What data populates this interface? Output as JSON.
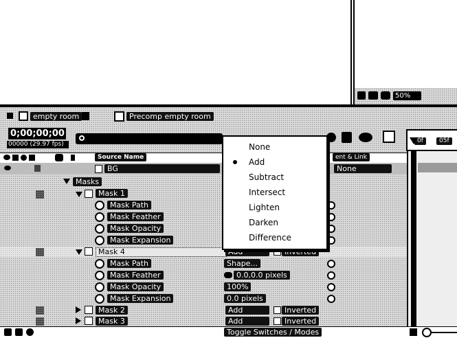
{
  "viewer": {
    "zoom": "50%"
  },
  "comp": {
    "tab_name": "empty room",
    "precomp_label": "Precomp empty room",
    "timecode": "0;00;00;00",
    "frame_info": "00000 (29.97 fps)"
  },
  "columns": {
    "source_name": "Source Name",
    "parent": "ent & Link"
  },
  "layers": {
    "bg_name": "BG",
    "parent_value": "None",
    "masks_group": "Masks",
    "mask1": "Mask 1",
    "mask4": "Mask 4",
    "mask2": "Mask 2",
    "mask3": "Mask 3",
    "mask_path": "Mask Path",
    "mask_feather": "Mask Feather",
    "mask_opacity": "Mask Opacity",
    "mask_expansion": "Mask Expansion",
    "mode_add": "Add",
    "inverted": "Inverted",
    "path_value": "Shape...",
    "feather_value": "0.0,0.0 pixels",
    "opacity_value": "100%",
    "expansion_value": "0.0 pixels"
  },
  "timeline": {
    "tick1": "0f",
    "tick2": "05f"
  },
  "bottom": {
    "toggle_label": "Toggle Switches / Modes"
  },
  "dropdown": {
    "items": [
      "None",
      "Add",
      "Subtract",
      "Intersect",
      "Lighten",
      "Darken",
      "Difference"
    ],
    "selected": "Add"
  }
}
